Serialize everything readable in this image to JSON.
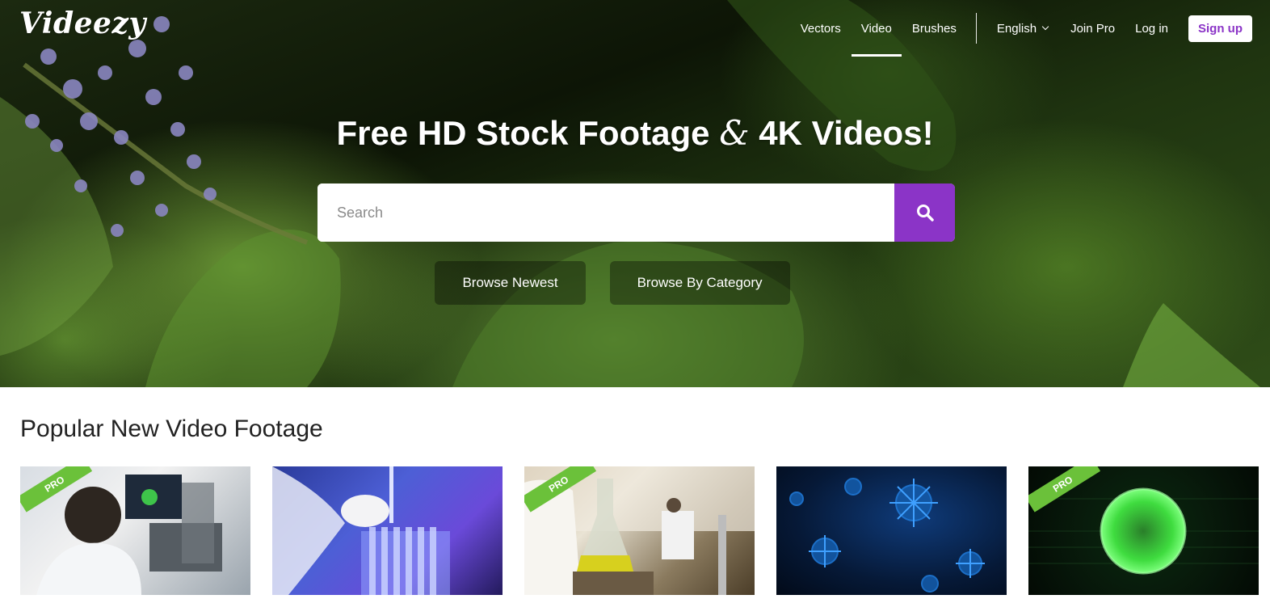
{
  "brand": {
    "logo_text": "Videezy",
    "accent": "#8b34c7",
    "pro_badge_color": "#6bc13a"
  },
  "nav": {
    "items": [
      {
        "label": "Vectors",
        "active": false
      },
      {
        "label": "Video",
        "active": true
      },
      {
        "label": "Brushes",
        "active": false
      }
    ],
    "language": "English",
    "join_pro": "Join Pro",
    "login": "Log in",
    "signup": "Sign up"
  },
  "hero": {
    "headline_part1": "Free HD Stock Footage",
    "headline_amp": "&",
    "headline_part2": "4K Videos!",
    "search_placeholder": "Search",
    "search_icon": "search-icon",
    "browse_newest": "Browse Newest",
    "browse_category": "Browse By Category"
  },
  "section": {
    "title": "Popular New Video Footage",
    "videos": [
      {
        "pro": true,
        "badge": "PRO",
        "subject": "scientist-at-microscope"
      },
      {
        "pro": false,
        "badge": "",
        "subject": "pipette-test-tubes"
      },
      {
        "pro": true,
        "badge": "PRO",
        "subject": "laboratory-flask"
      },
      {
        "pro": false,
        "badge": "",
        "subject": "blue-virus"
      },
      {
        "pro": true,
        "badge": "PRO",
        "subject": "green-cell"
      }
    ]
  }
}
